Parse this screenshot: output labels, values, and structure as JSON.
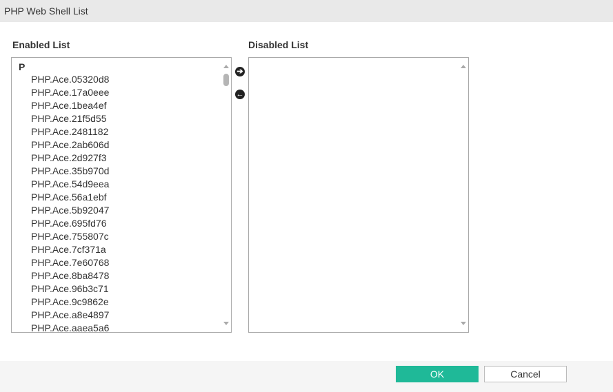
{
  "dialog": {
    "title": "PHP Web Shell List"
  },
  "enabled": {
    "label": "Enabled List",
    "group": "P",
    "items": [
      "PHP.Ace.05320d8",
      "PHP.Ace.17a0eee",
      "PHP.Ace.1bea4ef",
      "PHP.Ace.21f5d55",
      "PHP.Ace.2481182",
      "PHP.Ace.2ab606d",
      "PHP.Ace.2d927f3",
      "PHP.Ace.35b970d",
      "PHP.Ace.54d9eea",
      "PHP.Ace.56a1ebf",
      "PHP.Ace.5b92047",
      "PHP.Ace.695fd76",
      "PHP.Ace.755807c",
      "PHP.Ace.7cf371a",
      "PHP.Ace.7e60768",
      "PHP.Ace.8ba8478",
      "PHP.Ace.96b3c71",
      "PHP.Ace.9c9862e",
      "PHP.Ace.a8e4897",
      "PHP.Ace.aaea5a6"
    ]
  },
  "disabled": {
    "label": "Disabled List",
    "items": []
  },
  "buttons": {
    "ok": "OK",
    "cancel": "Cancel",
    "move_right": "➔",
    "move_left": "←"
  },
  "colors": {
    "ok": "#1fb998"
  }
}
